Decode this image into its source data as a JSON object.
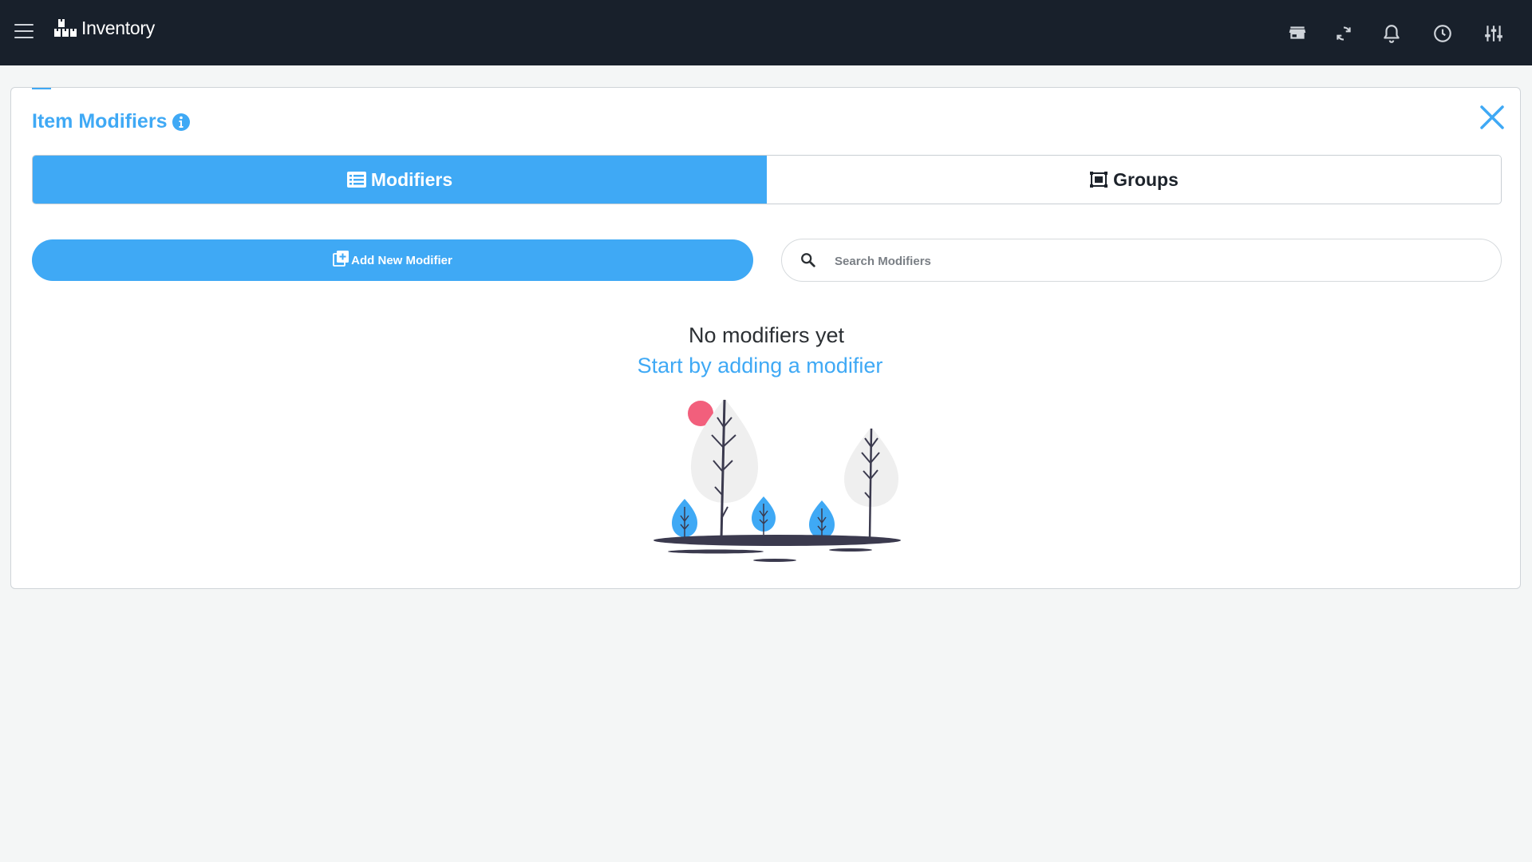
{
  "header": {
    "app_title": "Inventory",
    "icons": [
      "menu-icon",
      "boxes-logo-icon",
      "store-icon",
      "sync-icon",
      "bell-icon",
      "clock-icon",
      "sliders-icon"
    ]
  },
  "panel": {
    "title": "Item Modifiers",
    "tabs": [
      {
        "label": "Modifiers",
        "active": true
      },
      {
        "label": "Groups",
        "active": false
      }
    ],
    "add_button_label": "Add New Modifier",
    "search": {
      "placeholder": "Search Modifiers",
      "value": ""
    },
    "empty_state": {
      "title": "No modifiers yet",
      "subtitle": "Start by adding a modifier"
    }
  },
  "colors": {
    "accent": "#3fa9f5",
    "topbar": "#18202b",
    "background": "#f4f6f6",
    "sun": "#f25f7c",
    "tree_gray": "#efefef",
    "ground": "#3b3a4e"
  }
}
